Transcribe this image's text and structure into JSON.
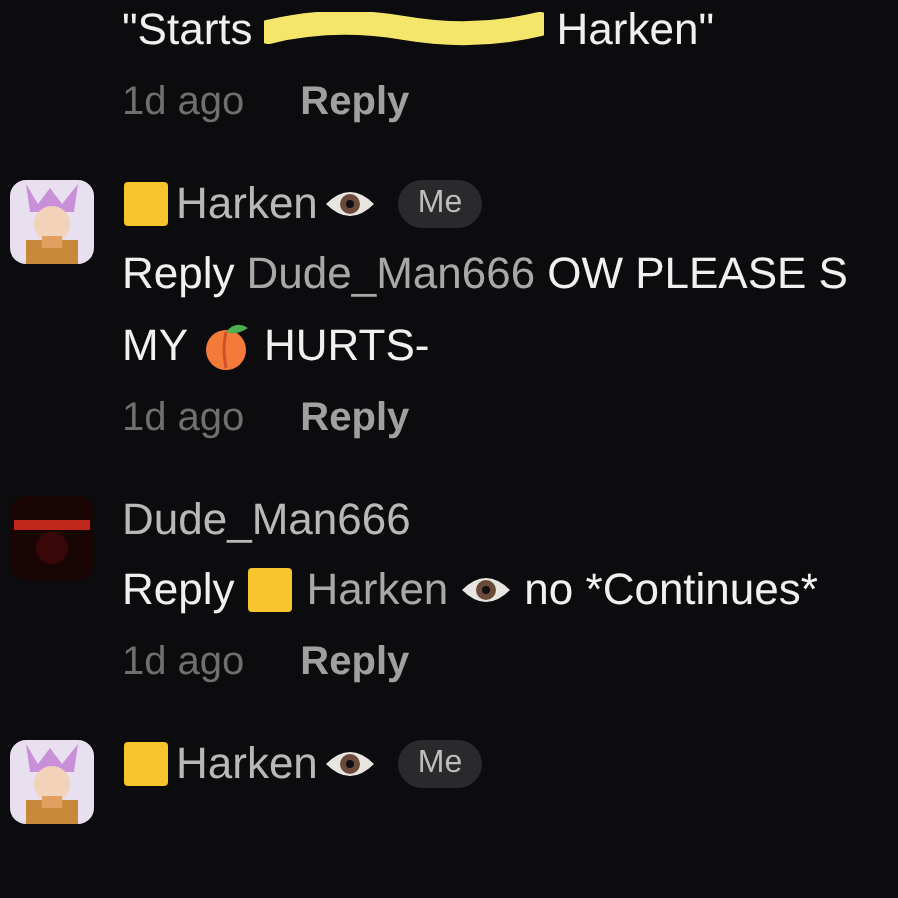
{
  "comments": [
    {
      "lines": [
        [
          {
            "kind": "text",
            "text": "\"Starts"
          },
          {
            "kind": "redaction"
          },
          {
            "kind": "text",
            "text": "Harken\""
          }
        ]
      ],
      "time": "1d ago",
      "reply": "Reply"
    },
    {
      "author": [
        {
          "kind": "square"
        },
        {
          "kind": "name",
          "text": "Harken"
        },
        {
          "kind": "eye"
        },
        {
          "kind": "badge",
          "text": "Me"
        }
      ],
      "lines": [
        [
          {
            "kind": "text",
            "text": "Reply"
          },
          {
            "kind": "mention",
            "text": "Dude_Man666"
          },
          {
            "kind": "text",
            "text": "OW PLEASE S"
          }
        ],
        [
          {
            "kind": "text",
            "text": "MY"
          },
          {
            "kind": "peach"
          },
          {
            "kind": "text",
            "text": "HURTS-"
          }
        ]
      ],
      "time": "1d ago",
      "reply": "Reply"
    },
    {
      "author": [
        {
          "kind": "name",
          "text": "Dude_Man666"
        }
      ],
      "lines": [
        [
          {
            "kind": "text",
            "text": "Reply"
          },
          {
            "kind": "square"
          },
          {
            "kind": "mention",
            "text": "Harken"
          },
          {
            "kind": "eye"
          },
          {
            "kind": "text",
            "text": "no *Continues*"
          }
        ]
      ],
      "time": "1d ago",
      "reply": "Reply"
    },
    {
      "author": [
        {
          "kind": "square"
        },
        {
          "kind": "name",
          "text": "Harken"
        },
        {
          "kind": "eye"
        },
        {
          "kind": "badge",
          "text": "Me"
        }
      ]
    }
  ]
}
